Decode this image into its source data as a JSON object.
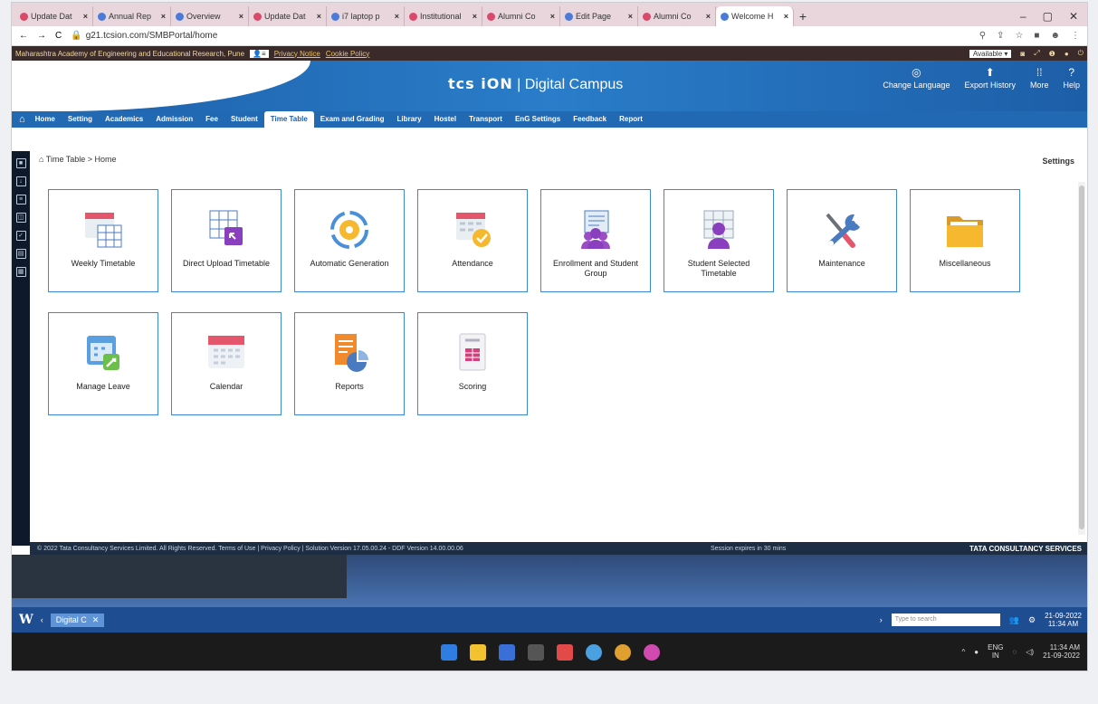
{
  "browser": {
    "tabs": [
      {
        "label": "Update Dat",
        "active": false
      },
      {
        "label": "Annual Rep",
        "active": false
      },
      {
        "label": "Overview",
        "active": false
      },
      {
        "label": "Update Dat",
        "active": false
      },
      {
        "label": "i7 laptop p",
        "active": false
      },
      {
        "label": "Institutional",
        "active": false
      },
      {
        "label": "Alumni Co",
        "active": false
      },
      {
        "label": "Edit Page",
        "active": false
      },
      {
        "label": "Alumni Co",
        "active": false
      },
      {
        "label": "Welcome H",
        "active": true
      }
    ],
    "new_tab": "+",
    "url": "g21.tcsion.com/SMBPortal/home"
  },
  "orgbar": {
    "institute": "Maharashtra Academy of Engineering and Educational Research, Pune",
    "privacy": "Privacy Notice",
    "cookie": "Cookie Policy",
    "status": "Available"
  },
  "header": {
    "brand": "tcs iON",
    "brand_suffix": "| Digital Campus",
    "actions": [
      {
        "label": "Change Language",
        "icon": "globe-icon"
      },
      {
        "label": "Export History",
        "icon": "upload-icon"
      },
      {
        "label": "More",
        "icon": "grid-icon"
      },
      {
        "label": "Help",
        "icon": "help-icon"
      }
    ]
  },
  "nav": {
    "items": [
      "Home",
      "Setting",
      "Academics",
      "Admission",
      "Fee",
      "Student",
      "Time Table",
      "Exam and Grading",
      "Library",
      "Hostel",
      "Transport",
      "EnG Settings",
      "Feedback",
      "Report"
    ],
    "active": "Time Table"
  },
  "page": {
    "breadcrumb": "Time Table > Home",
    "settings": "Settings"
  },
  "tiles": [
    {
      "label": "Weekly Timetable",
      "icon": "calendar-grid-icon"
    },
    {
      "label": "Direct Upload Timetable",
      "icon": "upload-timetable-icon"
    },
    {
      "label": "Automatic Generation",
      "icon": "gear-cycle-icon"
    },
    {
      "label": "Attendance",
      "icon": "calendar-check-icon"
    },
    {
      "label": "Enrollment and Student Group",
      "icon": "student-group-icon"
    },
    {
      "label": "Student Selected Timetable",
      "icon": "student-timetable-icon"
    },
    {
      "label": "Maintenance",
      "icon": "tools-icon"
    },
    {
      "label": "Miscellaneous",
      "icon": "folder-icon"
    },
    {
      "label": "Manage Leave",
      "icon": "leave-calendar-icon"
    },
    {
      "label": "Calendar",
      "icon": "calendar-icon"
    },
    {
      "label": "Reports",
      "icon": "report-pie-icon"
    },
    {
      "label": "Scoring",
      "icon": "score-icon"
    }
  ],
  "footer": {
    "copyright": "© 2022 Tata Consultancy Services Limited. All Rights Reserved.  Terms of Use | Privacy Policy | Solution Version 17.05.00.24 - DDF Version 14.00.00.06",
    "session": "Session expires in 30 mins",
    "company": "TATA CONSULTANCY SERVICES"
  },
  "taskbar": {
    "window_label": "Digital C",
    "search_placeholder": "Type to search",
    "date1": "21-09-2022",
    "time1": "11:34 AM",
    "lang": "ENG",
    "lang2": "IN",
    "time2": "11:34 AM",
    "date2": "21-09-2022"
  },
  "colors": {
    "brand_blue": "#2269b3",
    "tile_border": "#3b8ad6"
  }
}
